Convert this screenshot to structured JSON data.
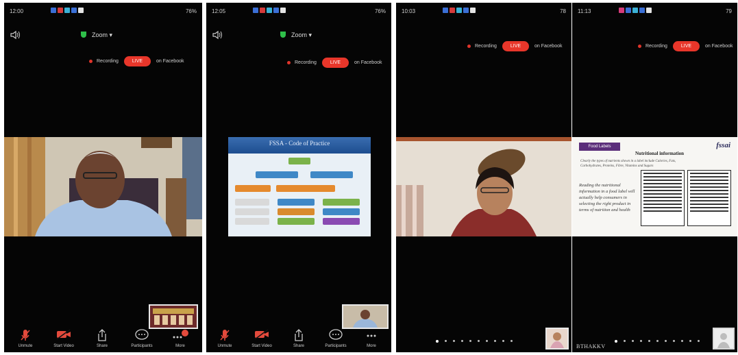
{
  "panels": [
    {
      "status": {
        "time": "12:00",
        "battery": "76%"
      },
      "meeting_title": "Zoom",
      "recording_label": "Recording",
      "live_label": "LIVE",
      "stream_target": "on Facebook",
      "bottom": [
        {
          "label": "Unmute",
          "icon": "mic-off-icon"
        },
        {
          "label": "Start Video",
          "icon": "video-off-icon"
        },
        {
          "label": "Share",
          "icon": "share-icon"
        },
        {
          "label": "Participants",
          "icon": "chat-icon"
        },
        {
          "label": "More",
          "icon": "more-icon"
        }
      ]
    },
    {
      "status": {
        "time": "12:05",
        "battery": "76%"
      },
      "meeting_title": "Zoom",
      "recording_label": "Recording",
      "live_label": "LIVE",
      "stream_target": "on Facebook",
      "slide_title": "FSSA - Code of Practice",
      "bottom": [
        {
          "label": "Unmute",
          "icon": "mic-off-icon"
        },
        {
          "label": "Start Video",
          "icon": "video-off-icon"
        },
        {
          "label": "Share",
          "icon": "share-icon"
        },
        {
          "label": "Participants",
          "icon": "chat-icon"
        },
        {
          "label": "More",
          "icon": "more-icon"
        }
      ]
    },
    {
      "status": {
        "time": "10:03",
        "battery": "78"
      },
      "recording_label": "Recording",
      "live_label": "LIVE",
      "stream_target": "on Facebook"
    },
    {
      "status": {
        "time": "11:13",
        "battery": "79"
      },
      "recording_label": "Recording",
      "live_label": "LIVE",
      "stream_target": "on Facebook",
      "caption": "BTHAKKV",
      "slide": {
        "tag": "Food Labels",
        "title": "Nutritional information",
        "logo": "fssai",
        "subtitle": "Clearly the types of nutrients shown in a label include Calories, Fats, Carbohydrates, Proteins, Fibre, Vitamins and Sugars",
        "body": "Reading the nutritional information in a food label will actually help consumers in selecting the right product in terms of nutrition and health"
      }
    }
  ],
  "colors": {
    "live": "#e8362a",
    "secure": "#2fbf4a",
    "background": "#050505"
  }
}
